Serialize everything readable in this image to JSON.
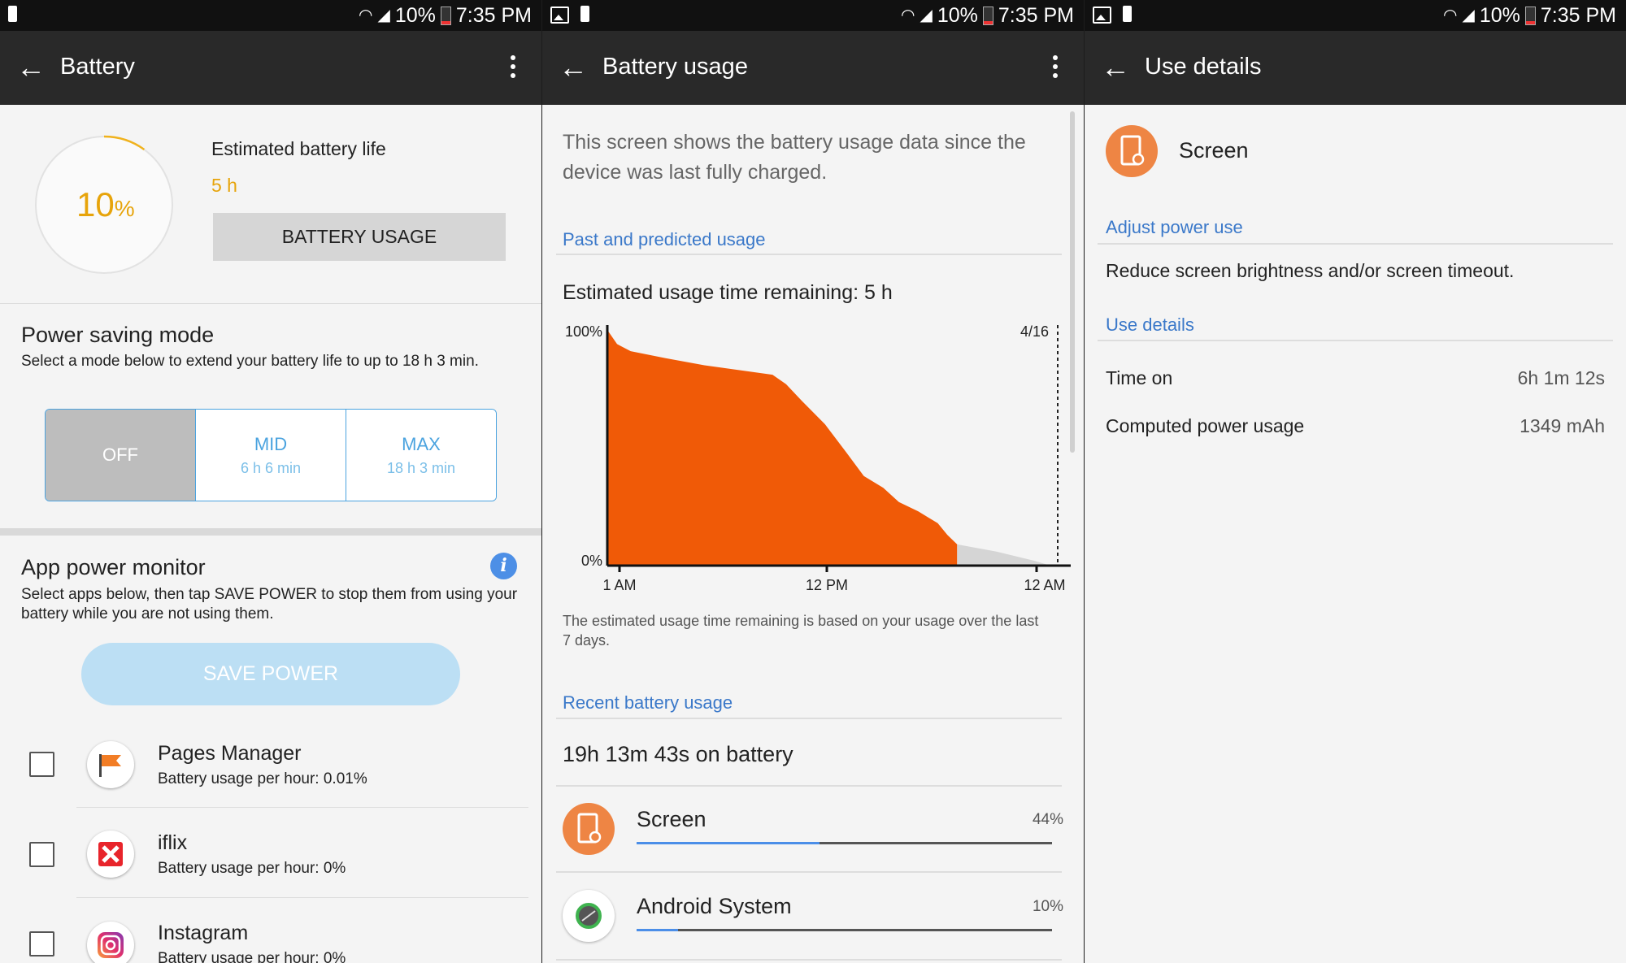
{
  "status": {
    "battery": "10%",
    "time": "7:35 PM"
  },
  "colors": {
    "accent_blue": "#3a78c9",
    "orange": "#f05a07",
    "gauge_text": "#e7a40b"
  },
  "battery": {
    "title": "Battery",
    "level_number": "10",
    "level_unit": "%",
    "level_fraction": 0.1,
    "est_label": "Estimated battery life",
    "est_value": "5 h",
    "usage_button": "BATTERY USAGE",
    "psm_title": "Power saving mode",
    "psm_desc": "Select a mode below to extend your battery life to up to 18 h 3 min.",
    "modes": [
      {
        "label": "OFF",
        "sub": ""
      },
      {
        "label": "MID",
        "sub": "6 h 6 min"
      },
      {
        "label": "MAX",
        "sub": "18 h 3 min"
      }
    ],
    "apm_title": "App power monitor",
    "apm_desc": "Select apps below, then tap SAVE POWER to stop them from using your battery while you are not using them.",
    "info_icon": "i",
    "save_power": "SAVE POWER",
    "apps": [
      {
        "name": "Pages Manager",
        "usage": "Battery usage per hour: 0.01%",
        "icon": "flag-icon"
      },
      {
        "name": "iflix",
        "usage": "Battery usage per hour: 0%",
        "icon": "iflix-icon"
      },
      {
        "name": "Instagram",
        "usage": "Battery usage per hour: 0%",
        "icon": "instagram-icon"
      }
    ]
  },
  "usage": {
    "title": "Battery usage",
    "intro": "This screen shows the battery usage data since the device was last fully charged.",
    "past_header": "Past and predicted usage",
    "est_remaining": "Estimated usage time remaining: 5 h",
    "chart_note": "The estimated usage time remaining is based on your usage over the last 7 days.",
    "recent_header": "Recent battery usage",
    "on_battery": "19h 13m 43s on battery",
    "items": [
      {
        "name": "Screen",
        "percent": "44%",
        "fraction": 0.44,
        "icon": "screen-settings-icon"
      },
      {
        "name": "Android System",
        "percent": "10%",
        "fraction": 0.1,
        "icon": "android-system-icon"
      }
    ]
  },
  "chart_data": {
    "type": "area",
    "y_tick_labels": [
      "100%",
      "0%"
    ],
    "x_tick_labels": [
      "1 AM",
      "12 PM",
      "12 AM"
    ],
    "marker_label": "4/16",
    "ylim": [
      0,
      100
    ],
    "series": [
      {
        "values": [
          [
            0,
            100
          ],
          [
            0.5,
            94
          ],
          [
            1.2,
            91
          ],
          [
            3,
            88
          ],
          [
            5,
            85
          ],
          [
            8.5,
            81
          ],
          [
            9.2,
            77
          ],
          [
            10,
            70
          ],
          [
            11.2,
            60
          ],
          [
            12.3,
            48
          ],
          [
            13.2,
            38
          ],
          [
            14.2,
            33
          ],
          [
            15,
            27
          ],
          [
            16,
            23
          ],
          [
            17,
            18
          ],
          [
            17.5,
            13
          ],
          [
            18,
            9
          ]
        ]
      },
      {
        "values": [
          [
            18,
            9
          ],
          [
            20,
            6
          ],
          [
            22,
            2
          ],
          [
            22.8,
            0
          ]
        ]
      }
    ]
  },
  "details": {
    "title": "Use details",
    "item_name": "Screen",
    "adjust_header": "Adjust power use",
    "adjust_text": "Reduce screen brightness and/or screen timeout.",
    "use_header": "Use details",
    "rows": [
      {
        "label": "Time on",
        "value": "6h 1m 12s"
      },
      {
        "label": "Computed power usage",
        "value": "1349 mAh"
      }
    ]
  }
}
